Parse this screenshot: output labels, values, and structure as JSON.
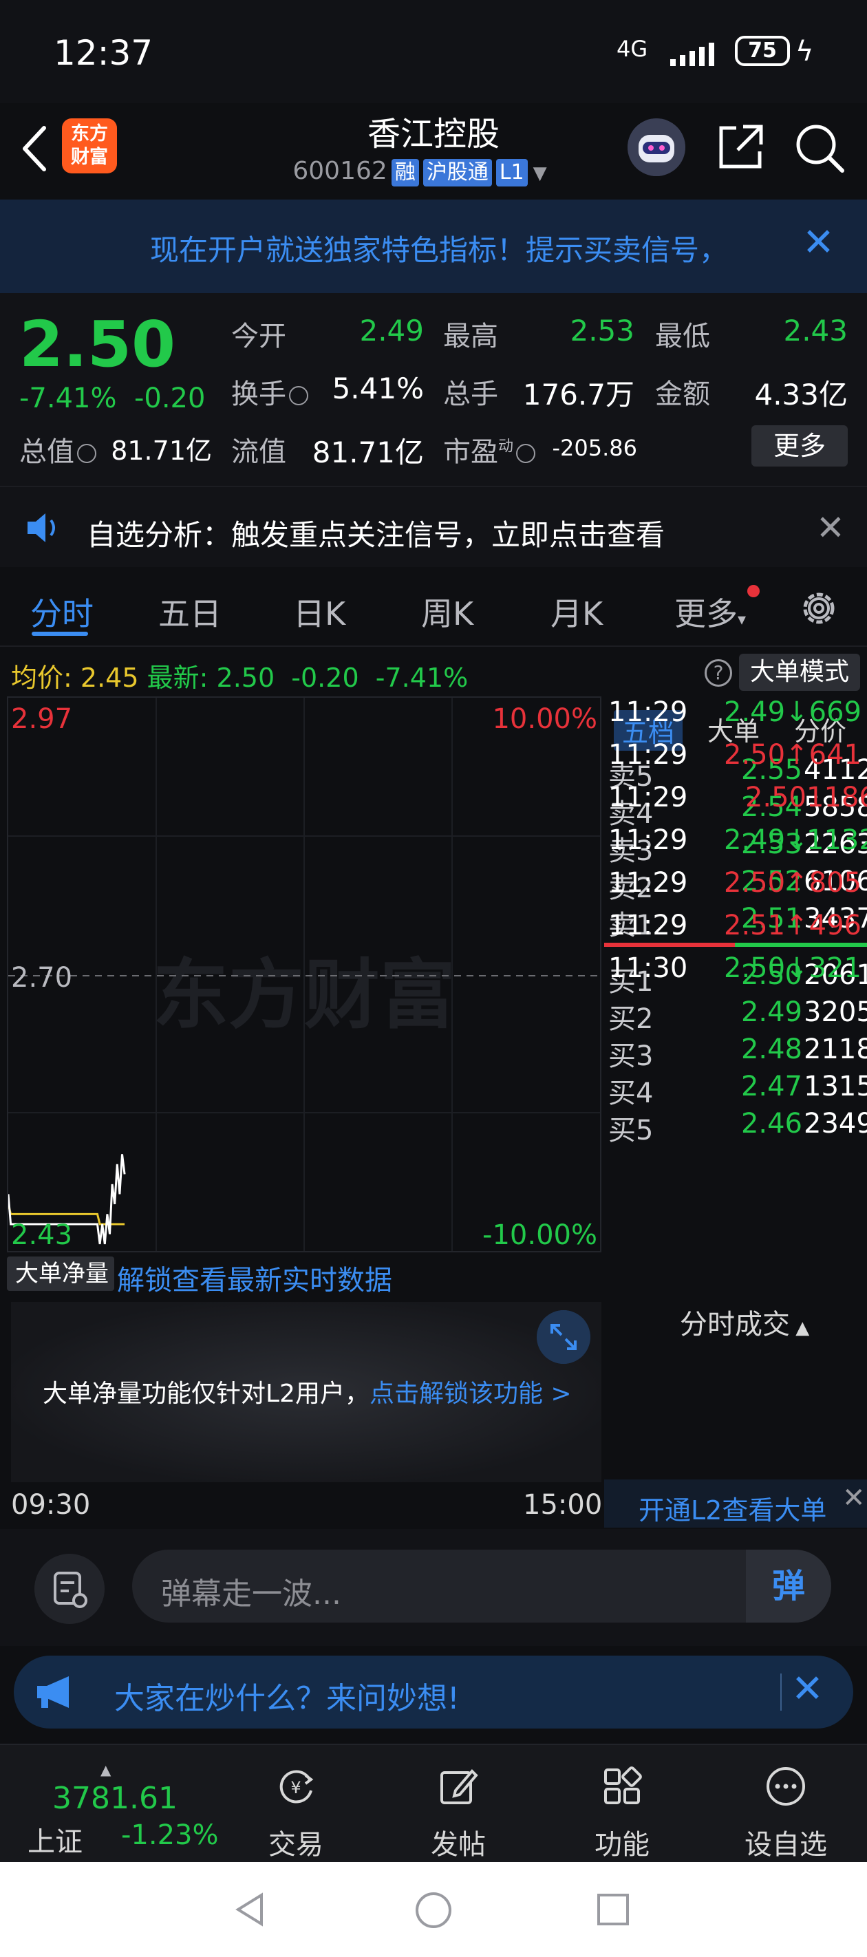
{
  "status_bar": {
    "time": "12:37",
    "network": "4G",
    "battery": "75"
  },
  "header": {
    "logo_text": "东方财富",
    "title": "香江控股",
    "code": "600162",
    "tags": [
      "融",
      "沪股通",
      "L1"
    ]
  },
  "banner": {
    "text": "现在开户就送独家特色指标！提示买卖信号，"
  },
  "quote": {
    "price": "2.50",
    "change_pct": "-7.41%",
    "change": "-0.20",
    "open_label": "今开",
    "open": "2.49",
    "high_label": "最高",
    "high": "2.53",
    "low_label": "最低",
    "low": "2.43",
    "turnover_label": "换手",
    "turnover": "5.41%",
    "volume_label": "总手",
    "volume": "176.7万",
    "amount_label": "金额",
    "amount": "4.33亿",
    "mktcap_label": "总值",
    "mktcap": "81.71亿",
    "float_label": "流值",
    "float": "81.71亿",
    "pe_label": "市盈",
    "pe_sup": "动",
    "pe": "-205.86",
    "more_button": "更多"
  },
  "notice": {
    "text": "自选分析：触发重点关注信号，立即点击查看"
  },
  "tabs": [
    "分时",
    "五日",
    "日K",
    "周K",
    "月K",
    "更多"
  ],
  "avg_line": {
    "avg_label": "均价:",
    "avg": "2.45",
    "latest_label": "最新:",
    "latest": "2.50",
    "change": "-0.20",
    "change_pct": "-7.41%",
    "mode_button": "大单模式"
  },
  "chart_data": {
    "type": "line",
    "y_top": "2.97",
    "y_mid": "2.70",
    "y_bottom": "2.43",
    "pct_top": "10.00%",
    "pct_bottom": "-10.00%",
    "ylim": [
      2.43,
      2.97
    ],
    "x_start": "09:30",
    "x_end": "15:00",
    "watermark": "东方财富",
    "price_series": [
      2.48,
      2.45,
      2.45,
      2.45,
      2.45,
      2.45,
      2.45,
      2.45,
      2.45,
      2.45,
      2.45,
      2.45,
      2.45,
      2.45,
      2.45,
      2.45,
      2.45,
      2.45,
      2.45,
      2.45,
      2.45,
      2.45,
      2.45,
      2.45,
      2.45,
      2.45,
      2.45,
      2.45,
      2.45,
      2.45,
      2.45,
      2.45,
      2.45,
      2.45,
      2.45,
      2.45,
      2.45,
      2.43,
      2.45,
      2.43,
      2.46,
      2.44,
      2.49,
      2.47,
      2.51,
      2.48,
      2.52,
      2.5
    ],
    "avg_series": [
      2.47,
      2.46,
      2.46,
      2.46,
      2.46,
      2.46,
      2.46,
      2.46,
      2.46,
      2.46,
      2.46,
      2.46,
      2.46,
      2.46,
      2.46,
      2.46,
      2.46,
      2.46,
      2.46,
      2.46,
      2.46,
      2.46,
      2.46,
      2.46,
      2.46,
      2.46,
      2.46,
      2.46,
      2.46,
      2.46,
      2.46,
      2.46,
      2.46,
      2.46,
      2.46,
      2.46,
      2.46,
      2.45,
      2.45,
      2.45,
      2.45,
      2.45,
      2.45,
      2.45,
      2.45,
      2.45,
      2.45,
      2.45
    ],
    "series_count_total": 240
  },
  "orderbook": {
    "tabs": [
      "五档",
      "大单",
      "分价"
    ],
    "sell": [
      {
        "k": "卖5",
        "p": "2.55",
        "v": "4112"
      },
      {
        "k": "卖4",
        "p": "2.54",
        "v": "5858"
      },
      {
        "k": "卖3",
        "p": "2.53",
        "v": "2263"
      },
      {
        "k": "卖2",
        "p": "2.52",
        "v": "6106"
      },
      {
        "k": "卖1",
        "p": "2.51",
        "v": "3437"
      }
    ],
    "buy": [
      {
        "k": "买1",
        "p": "2.50",
        "v": "2061"
      },
      {
        "k": "买2",
        "p": "2.49",
        "v": "3205"
      },
      {
        "k": "买3",
        "p": "2.48",
        "v": "2118"
      },
      {
        "k": "买4",
        "p": "2.47",
        "v": "1315"
      },
      {
        "k": "买5",
        "p": "2.46",
        "v": "2349"
      }
    ],
    "trades_title": "分时成交",
    "trades": [
      {
        "t": "11:29",
        "p": "2.49↓",
        "v": "669",
        "c": "green"
      },
      {
        "t": "11:29",
        "p": "2.50↑",
        "v": "641",
        "c": "red"
      },
      {
        "t": "11:29",
        "p": "2.50",
        "v": "1186",
        "c": "red"
      },
      {
        "t": "11:29",
        "p": "2.49↓",
        "v": "1132",
        "c": "green"
      },
      {
        "t": "11:29",
        "p": "2.50↑",
        "v": "805",
        "c": "red"
      },
      {
        "t": "11:29",
        "p": "2.51↑",
        "v": "496",
        "c": "red"
      },
      {
        "t": "11:30",
        "p": "2.50↓",
        "v": "321",
        "c": "green"
      }
    ],
    "l2_link": "开通L2查看大单"
  },
  "volume_panel": {
    "selector": "大单净量",
    "unlock_link": "解锁查看最新实时数据",
    "lock_text": "大单净量功能仅针对L2用户，",
    "lock_link": "点击解锁该功能 >"
  },
  "comment": {
    "placeholder": "弹幕走一波...",
    "send_button": "弹"
  },
  "ask": {
    "text": "大家在炒什么？来问妙想!"
  },
  "nav": {
    "index_value": "3781.61",
    "index_name": "上证",
    "index_change": "-1.23%",
    "items": [
      "交易",
      "发帖",
      "功能",
      "设自选"
    ]
  },
  "colors": {
    "up": "#e8323a",
    "down": "#22c94a",
    "accent": "#3b8df2",
    "avg": "#e8c72d"
  }
}
